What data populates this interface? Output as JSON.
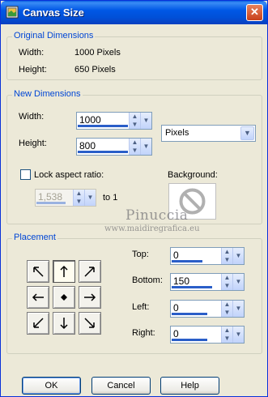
{
  "window": {
    "title": "Canvas Size",
    "close_glyph": "✕"
  },
  "original": {
    "legend": "Original Dimensions",
    "width_label": "Width:",
    "width_value": "1000 Pixels",
    "height_label": "Height:",
    "height_value": "650 Pixels"
  },
  "newdim": {
    "legend": "New Dimensions",
    "width_label": "Width:",
    "width_value": "1000",
    "height_label": "Height:",
    "height_value": "800",
    "units": "Pixels",
    "lock_label": "Lock aspect ratio:",
    "ratio_value": "1,538",
    "ratio_suffix": "to 1",
    "background_label": "Background:"
  },
  "placement": {
    "legend": "Placement",
    "top_label": "Top:",
    "top_value": "0",
    "bottom_label": "Bottom:",
    "bottom_value": "150",
    "left_label": "Left:",
    "left_value": "0",
    "right_label": "Right:",
    "right_value": "0"
  },
  "watermark": {
    "line1": "Pinuccia",
    "line2": "www.maidiregrafica.eu"
  },
  "buttons": {
    "ok": "OK",
    "cancel": "Cancel",
    "help": "Help"
  },
  "colors": {
    "titlebar": "#0058e6",
    "accent": "#0046d5",
    "spin_bar": "#2a5ec8"
  },
  "icons": [
    "canvas-size-icon",
    "close-icon",
    "no-background-icon",
    "arrow-icons",
    "spin-arrow-icon",
    "dropdown-icon"
  ]
}
